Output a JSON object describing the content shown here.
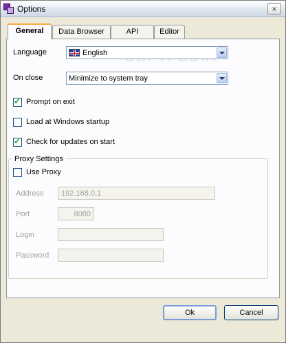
{
  "window": {
    "title": "Options",
    "close_glyph": "×"
  },
  "tabs": [
    {
      "label": "General",
      "active": true
    },
    {
      "label": "Data Browser",
      "active": false
    },
    {
      "label": "API",
      "active": false
    },
    {
      "label": "Editor",
      "active": false
    }
  ],
  "general": {
    "language": {
      "label": "Language",
      "value": "English",
      "icon": "uk-flag-icon"
    },
    "on_close": {
      "label": "On close",
      "value": "Minimize to system tray"
    },
    "checkboxes": [
      {
        "label": "Prompt on exit",
        "checked": true
      },
      {
        "label": "Load at Windows startup",
        "checked": false
      },
      {
        "label": "Check for updates on start",
        "checked": true
      }
    ],
    "check_glyph": "✓",
    "proxy": {
      "group_title": "Proxy Settings",
      "use_proxy": {
        "label": "Use Proxy",
        "checked": false
      },
      "address": {
        "label": "Address",
        "value": "192.168.0.1"
      },
      "port": {
        "label": "Port",
        "value": "8080"
      },
      "login": {
        "label": "Login",
        "value": ""
      },
      "password": {
        "label": "Password",
        "value": ""
      }
    }
  },
  "buttons": {
    "ok": "Ok",
    "cancel": "Cancel"
  },
  "watermark": "SOFTPEDIA"
}
